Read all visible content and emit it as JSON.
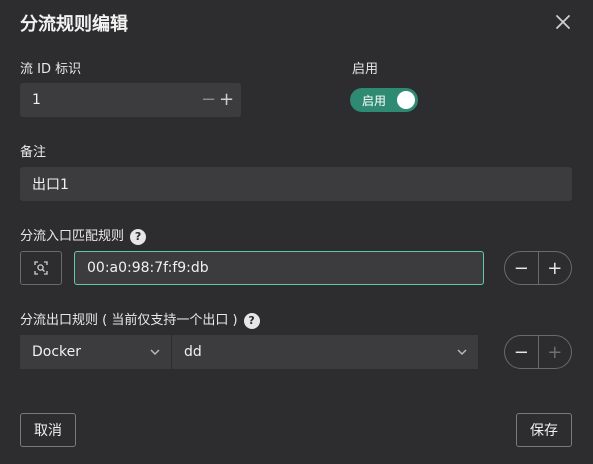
{
  "dialog": {
    "title": "分流规则编辑"
  },
  "flow_id": {
    "label": "流 ID 标识",
    "value": "1",
    "minus": "−",
    "plus": "+"
  },
  "enable": {
    "label": "启用",
    "toggle_text": "启用",
    "on": true,
    "color": "#2f8a74"
  },
  "remark": {
    "label": "备注",
    "value": "出口1"
  },
  "entry_rule": {
    "label": "分流入口匹配规则",
    "help": "?",
    "value": "00:a0:98:7f:f9:db",
    "minus": "−",
    "plus": "+"
  },
  "exit_rule": {
    "label": "分流出口规则 ( 当前仅支持一个出口 )",
    "help": "?",
    "type_select": "Docker",
    "target_select": "dd",
    "minus": "−",
    "plus": "+"
  },
  "footer": {
    "cancel_label": "取消",
    "save_label": "保存"
  },
  "colors": {
    "background": "#2d2d30",
    "field": "#3c3c3f",
    "accent": "#5fcaa8"
  },
  "icons": [
    "close-icon",
    "scan-icon",
    "help-icon",
    "chevron-down-icon"
  ]
}
